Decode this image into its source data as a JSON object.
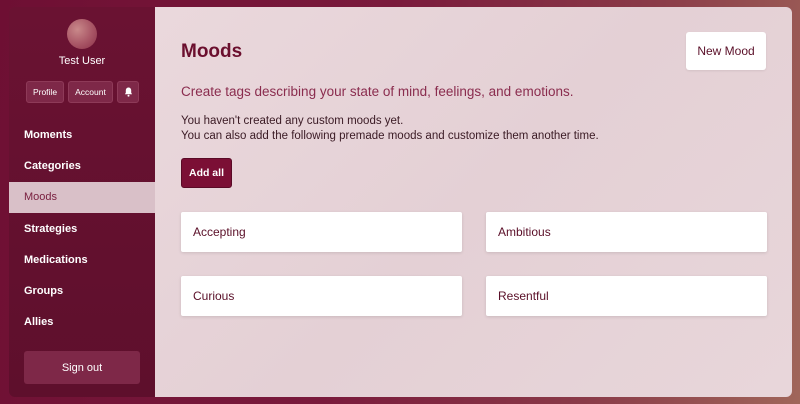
{
  "sidebar": {
    "username": "Test User",
    "profile_label": "Profile",
    "account_label": "Account",
    "notifications_icon": "bell-icon",
    "items": [
      {
        "label": "Moments"
      },
      {
        "label": "Categories"
      },
      {
        "label": "Moods",
        "active": true
      },
      {
        "label": "Strategies"
      },
      {
        "label": "Medications"
      },
      {
        "label": "Groups"
      },
      {
        "label": "Allies"
      }
    ],
    "signout_label": "Sign out"
  },
  "main": {
    "title": "Moods",
    "new_mood_label": "New Mood",
    "subtitle": "Create tags describing your state of mind, feelings, and emotions.",
    "info_line1": "You haven't created any custom moods yet.",
    "info_line2": "You can also add the following premade moods and customize them another time.",
    "add_all_label": "Add all",
    "moods": [
      "Accepting",
      "Ambitious",
      "Curious",
      "Resentful"
    ]
  },
  "colors": {
    "brand": "#6b0f2e",
    "accent_button": "#7b0f35",
    "active_nav_bg": "#d9c0c8"
  }
}
